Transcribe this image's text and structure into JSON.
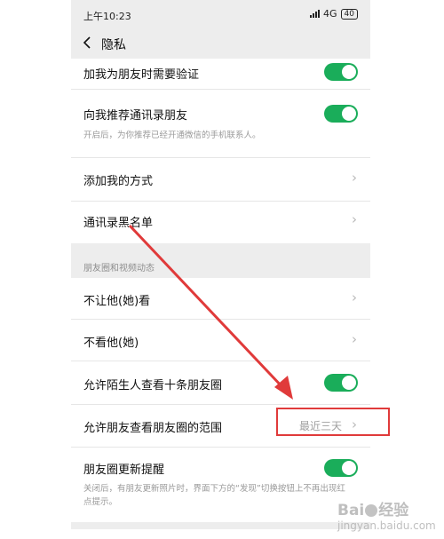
{
  "status_bar": {
    "time": "上午10:23",
    "network": "4G",
    "battery": "40"
  },
  "nav": {
    "title": "隐私"
  },
  "group1": {
    "add_verify": {
      "label": "加我为朋友时需要验证",
      "toggle_on": true
    },
    "recommend_contacts": {
      "label": "向我推荐通讯录朋友",
      "hint": "开启后，为你推荐已经开通微信的手机联系人。",
      "toggle_on": true
    },
    "add_methods": {
      "label": "添加我的方式"
    },
    "blacklist": {
      "label": "通讯录黑名单"
    }
  },
  "moments_section": {
    "title": "朋友圈和视频动态"
  },
  "group2": {
    "hide_my_posts": {
      "label": "不让他(她)看"
    },
    "hide_their_posts": {
      "label": "不看他(她)"
    },
    "stranger_ten": {
      "label": "允许陌生人查看十条朋友圈",
      "toggle_on": true
    },
    "visible_range": {
      "label": "允许朋友查看朋友圈的范围",
      "value": "最近三天"
    },
    "update_reminder": {
      "label": "朋友圈更新提醒",
      "hint": "关闭后，有朋友更新照片时，界面下方的“发现”切换按钮上不再出现红点提示。",
      "toggle_on": true
    }
  },
  "annotation": {
    "highlight_color": "#e03a3a"
  },
  "watermark": {
    "text": "Bai",
    "text2": "经验",
    "sub": "jingyan.baidu.com"
  },
  "colors": {
    "toggle_on": "#1aad5a",
    "background": "#ededed"
  }
}
